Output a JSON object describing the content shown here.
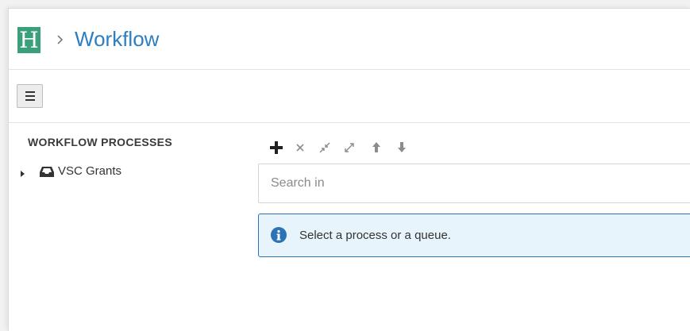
{
  "header": {
    "logo_letter": "H",
    "title": "Workflow"
  },
  "sidebar": {
    "title": "WORKFLOW PROCESSES",
    "items": [
      {
        "label": "VSC Grants"
      }
    ]
  },
  "main": {
    "actions": [
      "add-icon",
      "remove-icon",
      "collapse-icon",
      "expand-icon",
      "move-up-icon",
      "move-down-icon"
    ],
    "search": {
      "placeholder": "Search in",
      "value": ""
    },
    "info": {
      "message": "Select a process or a queue."
    }
  },
  "colors": {
    "logo_bg": "#3aa07a",
    "title": "#2b7fc2",
    "info_border": "#2c73b5",
    "info_bg": "#e8f4fb"
  }
}
